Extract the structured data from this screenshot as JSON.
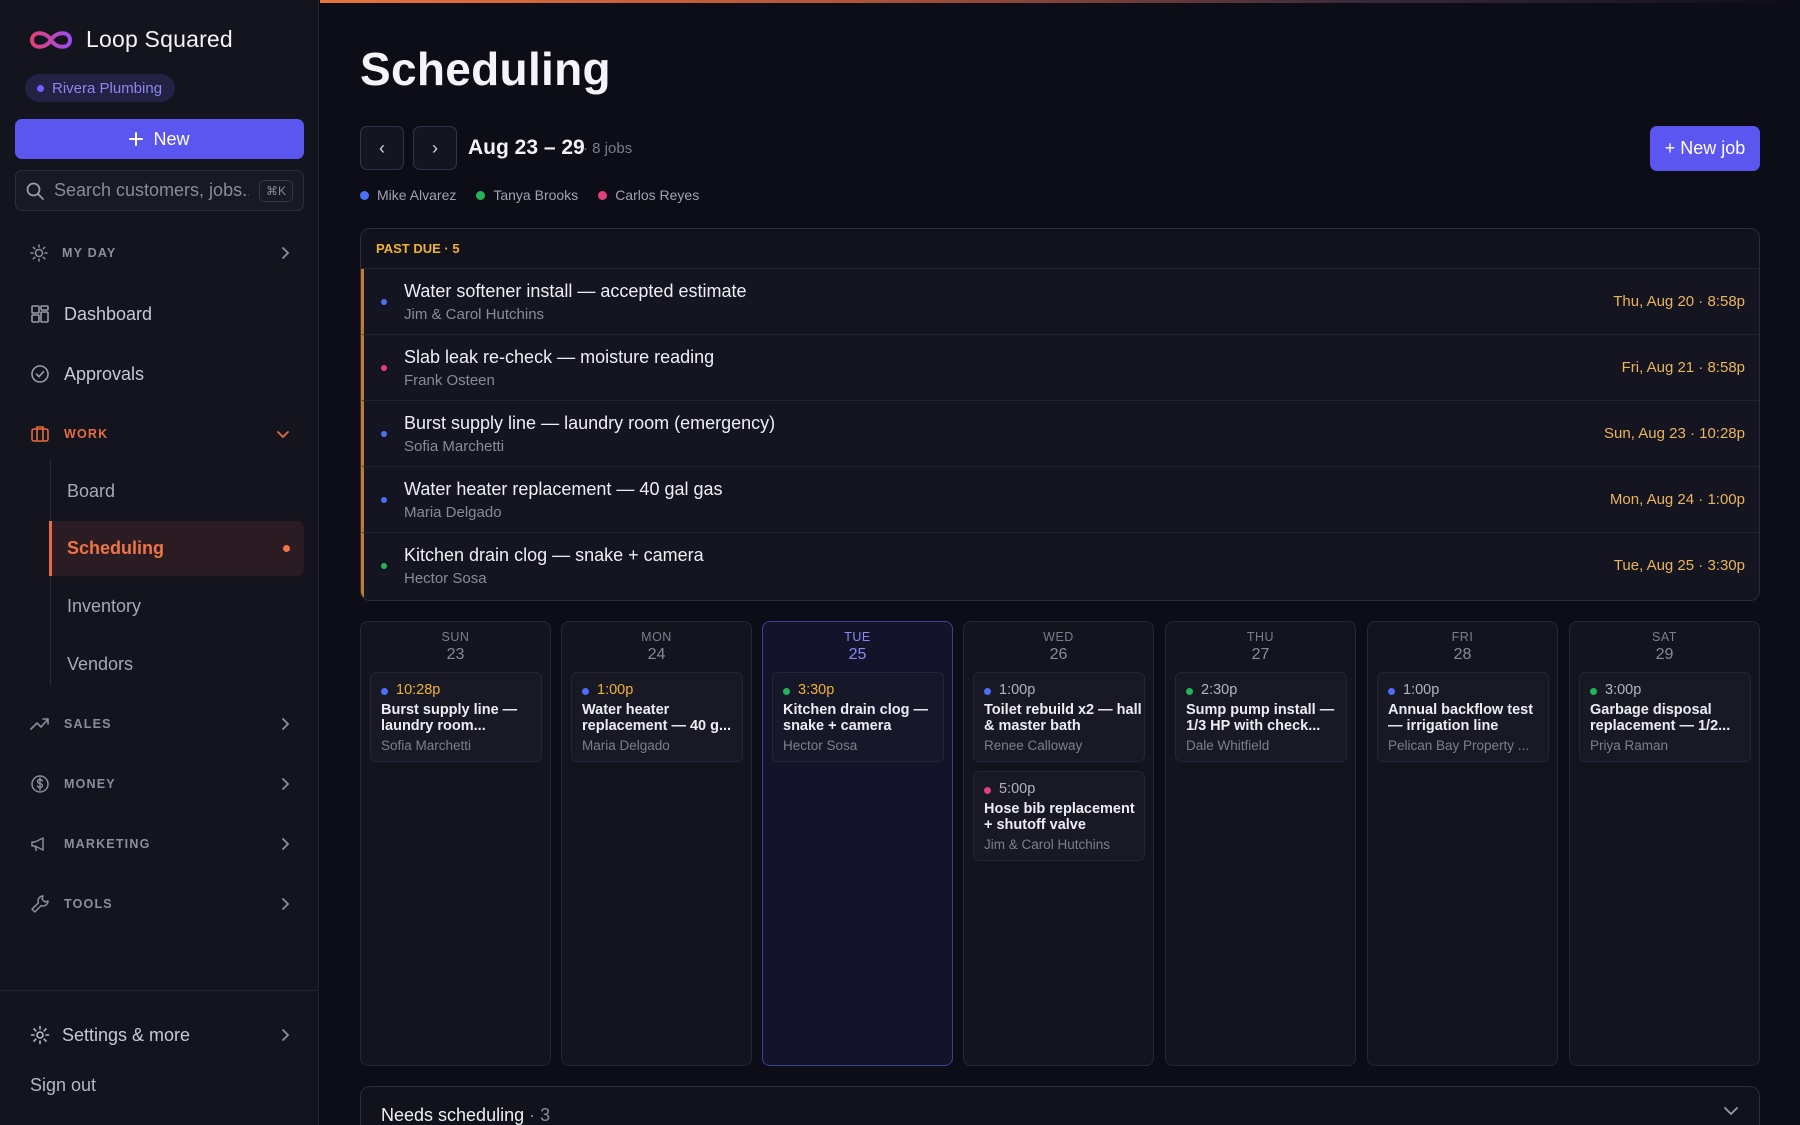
{
  "app": {
    "brand_name": "Loop Squared",
    "org_name": "Rivera Plumbing",
    "new_button": "New",
    "search_placeholder": "Search customers, jobs...",
    "search_shortcut": "⌘K"
  },
  "sidebar": {
    "my_day": "MY DAY",
    "dashboard": "Dashboard",
    "approvals": "Approvals",
    "work": "WORK",
    "work_items": [
      "Board",
      "Scheduling",
      "Inventory",
      "Vendors"
    ],
    "sales": "SALES",
    "money": "MONEY",
    "marketing": "MARKETING",
    "tools": "TOOLS",
    "settings": "Settings & more",
    "sign_out": "Sign out"
  },
  "main": {
    "title": "Scheduling",
    "week_range": "Aug 23 – 29",
    "jobs_count": "· 8 jobs",
    "new_job": "+ New job",
    "prev": "‹",
    "next": "›"
  },
  "legend": [
    {
      "name": "Mike Alvarez",
      "color": "#4f6ef7"
    },
    {
      "name": "Tanya Brooks",
      "color": "#22b45a"
    },
    {
      "name": "Carlos Reyes",
      "color": "#e0407a"
    }
  ],
  "past_due": {
    "header": "PAST DUE · 5",
    "rows": [
      {
        "title": "Water softener install — accepted estimate",
        "customer": "Jim & Carol Hutchins",
        "when": "Thu, Aug 20 · 8:58p",
        "color": "#4f6ef7"
      },
      {
        "title": "Slab leak re-check — moisture reading",
        "customer": "Frank Osteen",
        "when": "Fri, Aug 21 · 8:58p",
        "color": "#e0407a"
      },
      {
        "title": "Burst supply line — laundry room (emergency)",
        "customer": "Sofia Marchetti",
        "when": "Sun, Aug 23 · 10:28p",
        "color": "#4f6ef7"
      },
      {
        "title": "Water heater replacement — 40 gal gas",
        "customer": "Maria Delgado",
        "when": "Mon, Aug 24 · 1:00p",
        "color": "#4f6ef7"
      },
      {
        "title": "Kitchen drain clog — snake + camera",
        "customer": "Hector Sosa",
        "when": "Tue, Aug 25 · 3:30p",
        "color": "#22b45a"
      }
    ]
  },
  "days": [
    {
      "name": "SUN",
      "num": "23",
      "today": false,
      "jobs": [
        {
          "time": "10:28p",
          "late": true,
          "title": "Burst supply line — laundry room...",
          "customer": "Sofia Marchetti",
          "color": "#4f6ef7"
        }
      ]
    },
    {
      "name": "MON",
      "num": "24",
      "today": false,
      "jobs": [
        {
          "time": "1:00p",
          "late": true,
          "title": "Water heater replacement — 40 g...",
          "customer": "Maria Delgado",
          "color": "#4f6ef7"
        }
      ]
    },
    {
      "name": "TUE",
      "num": "25",
      "today": true,
      "jobs": [
        {
          "time": "3:30p",
          "late": true,
          "title": "Kitchen drain clog — snake + camera",
          "customer": "Hector Sosa",
          "color": "#22b45a"
        }
      ]
    },
    {
      "name": "WED",
      "num": "26",
      "today": false,
      "jobs": [
        {
          "time": "1:00p",
          "late": false,
          "title": "Toilet rebuild x2 — hall & master bath",
          "customer": "Renee Calloway",
          "color": "#4f6ef7"
        },
        {
          "time": "5:00p",
          "late": false,
          "title": "Hose bib replacement + shutoff valve",
          "customer": "Jim & Carol Hutchins",
          "color": "#e0407a"
        }
      ]
    },
    {
      "name": "THU",
      "num": "27",
      "today": false,
      "jobs": [
        {
          "time": "2:30p",
          "late": false,
          "title": "Sump pump install — 1/3 HP with check...",
          "customer": "Dale Whitfield",
          "color": "#22b45a"
        }
      ]
    },
    {
      "name": "FRI",
      "num": "28",
      "today": false,
      "jobs": [
        {
          "time": "1:00p",
          "late": false,
          "title": "Annual backflow test — irrigation line",
          "customer": "Pelican Bay Property ...",
          "color": "#4f6ef7"
        }
      ]
    },
    {
      "name": "SAT",
      "num": "29",
      "today": false,
      "jobs": [
        {
          "time": "3:00p",
          "late": false,
          "title": "Garbage disposal replacement — 1/2...",
          "customer": "Priya Raman",
          "color": "#22b45a"
        }
      ]
    }
  ],
  "needs_scheduling": {
    "label": "Needs scheduling",
    "count": "· 3"
  }
}
